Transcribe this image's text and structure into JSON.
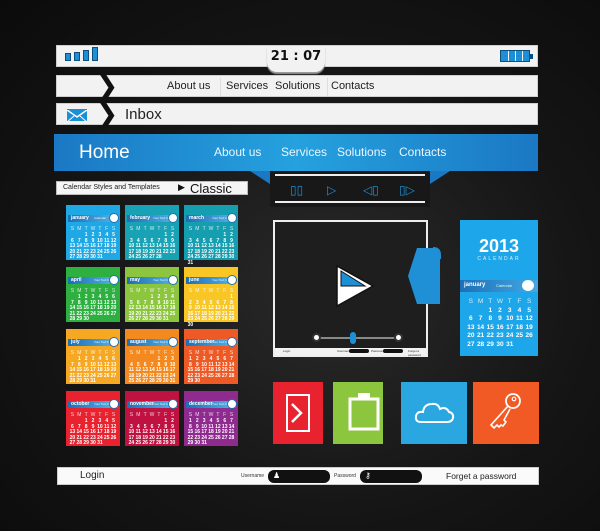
{
  "status_bar": {
    "time": "21 : 07",
    "signal_bars": 4,
    "battery_level": 1.0
  },
  "nav_bar": {
    "items": [
      "About us",
      "Services",
      "Solutions",
      "Contacts"
    ]
  },
  "inbox_bar": {
    "label": "Inbox",
    "icon": "envelope-icon"
  },
  "home_bar": {
    "home_label": "Home",
    "items": [
      "About us",
      "Services",
      "Solutions",
      "Contacts"
    ],
    "color": "#1f8fd6"
  },
  "media_controls": {
    "buttons": [
      "pause-icon",
      "play-icon",
      "previous-icon",
      "next-icon"
    ],
    "glyphs": [
      "▯▯",
      "▷",
      "◁▯",
      "▯▷"
    ]
  },
  "calendar_styles": {
    "label": "Calendar Styles and Templates",
    "arrow": "▶",
    "selected": "Classic"
  },
  "weekdays": [
    "S",
    "M",
    "T",
    "W",
    "T",
    "F",
    "S"
  ],
  "calendars": [
    {
      "month": "january",
      "note": "Calendar",
      "start": 2,
      "days": 31,
      "color": "#1ea8e6"
    },
    {
      "month": "february",
      "note": "Your Text here",
      "start": 5,
      "days": 28,
      "color": "#17a3b5"
    },
    {
      "month": "march",
      "note": "Your Text here",
      "start": 5,
      "days": 31,
      "color": "#159eb0"
    },
    {
      "month": "april",
      "note": "Your Text here",
      "start": 1,
      "days": 30,
      "color": "#2db040"
    },
    {
      "month": "may",
      "note": "Your Text here",
      "start": 3,
      "days": 31,
      "color": "#8cc63e"
    },
    {
      "month": "june",
      "note": "Your Text here",
      "start": 6,
      "days": 30,
      "color": "#f8c726"
    },
    {
      "month": "july",
      "note": "Your Text here",
      "start": 1,
      "days": 31,
      "color": "#f7a823"
    },
    {
      "month": "august",
      "note": "Your Text here",
      "start": 4,
      "days": 31,
      "color": "#f48a1f"
    },
    {
      "month": "september",
      "note": "Your Text here",
      "start": 0,
      "days": 30,
      "color": "#ee5a26"
    },
    {
      "month": "october",
      "note": "Your Text here",
      "start": 2,
      "days": 31,
      "color": "#e8222e"
    },
    {
      "month": "november",
      "note": "Your Text here",
      "start": 5,
      "days": 30,
      "color": "#c01240"
    },
    {
      "month": "december",
      "note": "Your Text here",
      "start": 0,
      "days": 31,
      "color": "#8f2a8f"
    }
  ],
  "player": {
    "progress": 0.44,
    "mini_login": {
      "login": "Login",
      "username": "Username",
      "password": "Password",
      "forgot": "Forget a password"
    }
  },
  "big_calendar": {
    "year": "2013",
    "subtitle": "CALENDAR",
    "month": "january",
    "note": "Calendar",
    "start": 2,
    "days": 31
  },
  "tiles": [
    {
      "name": "arrow-tile",
      "icon": "chevron-right-icon",
      "color": "#e8222e"
    },
    {
      "name": "clipboard-tile",
      "icon": "clipboard-icon",
      "color": "#8cc63e"
    },
    {
      "name": "cloud-tile",
      "icon": "cloud-icon",
      "color": "#2aa7e0"
    },
    {
      "name": "key-tile",
      "icon": "key-icon",
      "color": "#f15a24"
    }
  ],
  "login_bar": {
    "login": "Login",
    "username_label": "Username",
    "password_label": "Password",
    "forgot": "Forget a password"
  }
}
